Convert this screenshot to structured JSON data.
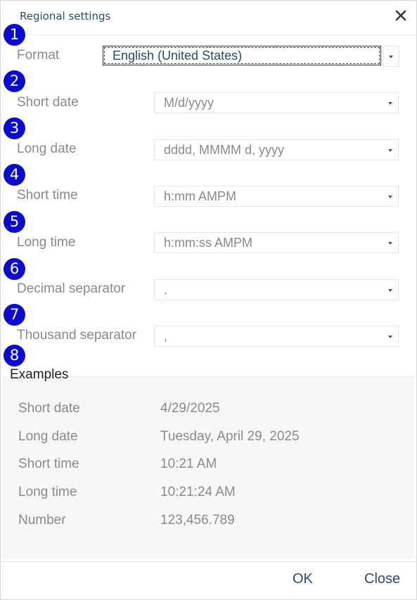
{
  "dialog": {
    "title": "Regional settings",
    "close_icon": "close-icon"
  },
  "fields": [
    {
      "number": "1",
      "label": "Format",
      "value": "English (United States)"
    },
    {
      "number": "2",
      "label": "Short date",
      "value": "M/d/yyyy"
    },
    {
      "number": "3",
      "label": "Long date",
      "value": "dddd, MMMM d, yyyy"
    },
    {
      "number": "4",
      "label": "Short time",
      "value": "h:mm AMPM"
    },
    {
      "number": "5",
      "label": "Long time",
      "value": "h:mm:ss AMPM"
    },
    {
      "number": "6",
      "label": "Decimal separator",
      "value": "."
    },
    {
      "number": "7",
      "label": "Thousand separator",
      "value": ","
    }
  ],
  "examples": {
    "badge": "8",
    "title": "Examples",
    "rows": [
      {
        "label": "Short date",
        "value": "4/29/2025"
      },
      {
        "label": "Long date",
        "value": "Tuesday, April 29, 2025"
      },
      {
        "label": "Short time",
        "value": "10:21 AM"
      },
      {
        "label": "Long time",
        "value": "10:21:24 AM"
      },
      {
        "label": "Number",
        "value": "123,456.789"
      }
    ]
  },
  "footer": {
    "ok_label": "OK",
    "close_label": "Close"
  },
  "colors": {
    "badge": "#0b0bcf",
    "accent_text": "#2b4a6b",
    "muted_text": "#8a8a8a"
  }
}
